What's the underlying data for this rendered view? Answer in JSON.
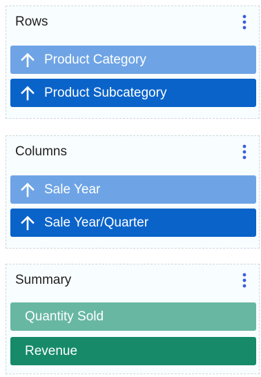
{
  "panels": {
    "rows": {
      "title": "Rows",
      "items": [
        {
          "label": "Product Category",
          "icon": "arrow-up-icon"
        },
        {
          "label": "Product Subcategory",
          "icon": "arrow-up-icon"
        }
      ]
    },
    "columns": {
      "title": "Columns",
      "items": [
        {
          "label": "Sale Year",
          "icon": "arrow-up-icon"
        },
        {
          "label": "Sale Year/Quarter",
          "icon": "arrow-up-icon"
        }
      ]
    },
    "summary": {
      "title": "Summary",
      "items": [
        {
          "label": "Quantity Sold"
        },
        {
          "label": "Revenue"
        }
      ]
    }
  },
  "menu_icon": "vertical-ellipsis-icon",
  "colors": {
    "rows_item_1": "#6ea4e5",
    "rows_item_2": "#0a63c9",
    "summary_item_1": "#68b7a3",
    "summary_item_2": "#168a69",
    "menu_dots": "#3c5de3"
  }
}
